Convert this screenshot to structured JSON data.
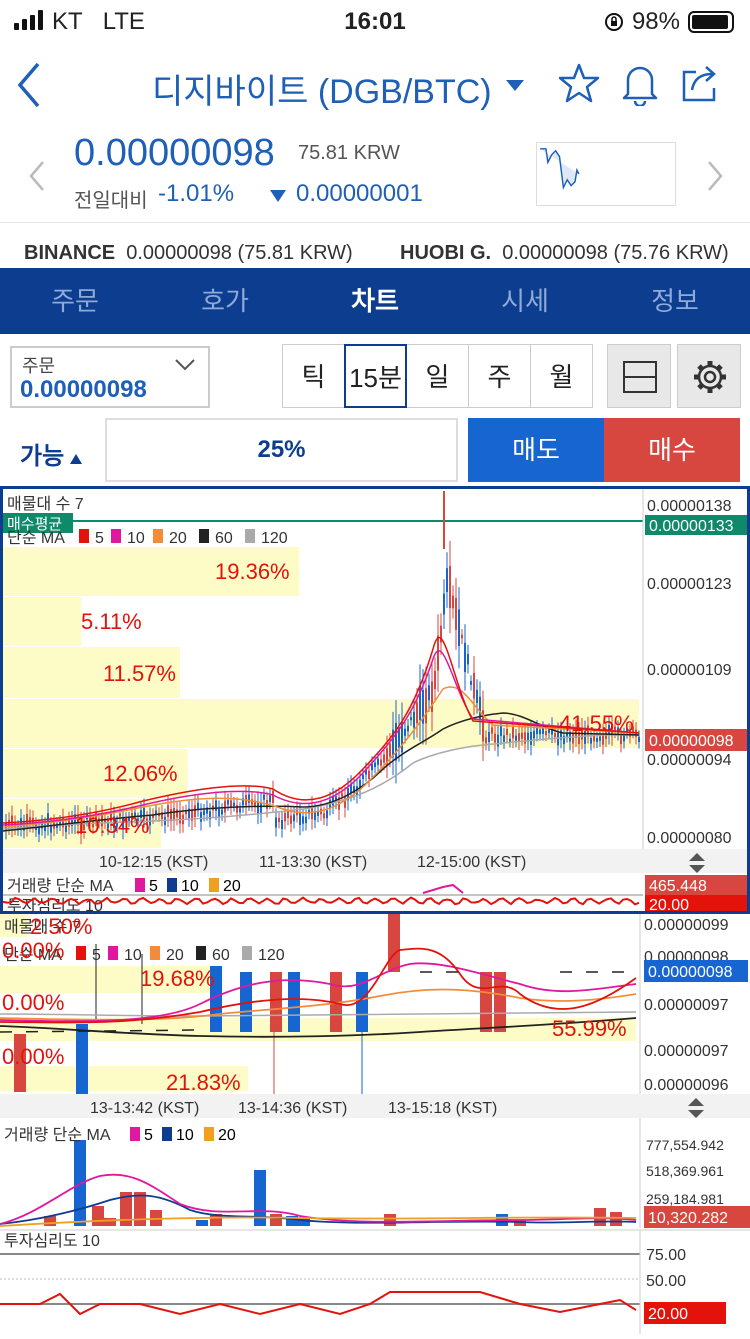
{
  "status": {
    "carrier": "KT",
    "network": "LTE",
    "time": "16:01",
    "battery": "98%"
  },
  "header": {
    "title": "디지바이트 (DGB/BTC)"
  },
  "price": {
    "value": "0.00000098",
    "krw": "75.81 KRW",
    "change_label": "전일대비",
    "change_pct": "-1.01%",
    "change_abs": "0.00000001"
  },
  "exchanges": [
    {
      "name": "BINANCE",
      "value": "0.00000098 (75.81 KRW)"
    },
    {
      "name": "HUOBI G.",
      "value": "0.00000098 (75.76 KRW)"
    }
  ],
  "tabs": [
    "주문",
    "호가",
    "차트",
    "시세",
    "정보"
  ],
  "active_tab": "차트",
  "order": {
    "label": "주문",
    "value": "0.00000098"
  },
  "periods": [
    "틱",
    "15분",
    "일",
    "주",
    "월"
  ],
  "active_period": "15분",
  "available_label": "가능",
  "percent": "25%",
  "sell_label": "매도",
  "buy_label": "매수",
  "colors": {
    "navy": "#0d3d8f",
    "blue": "#1e5fb8",
    "red": "#d7473f",
    "sell": "#1765d1"
  },
  "chart1": {
    "title": "매물대 수 7",
    "avg_label": "매수평균",
    "ma_legend": {
      "label": "단순 MA",
      "periods": [
        "5",
        "10",
        "20",
        "60",
        "120"
      ]
    },
    "yticks": [
      "0.00000138",
      "0.00000123",
      "0.00000109",
      "0.00000094",
      "0.00000080"
    ],
    "avg_price": "0.00000133",
    "cur_price": "0.00000098",
    "xticks": [
      "10-12:15 (KST)",
      "11-13:30 (KST)",
      "12-15:00 (KST)"
    ],
    "volume_profile": [
      {
        "label": "19.36%"
      },
      {
        "label": "5.11%"
      },
      {
        "label": "11.57%"
      },
      {
        "label": "41.55%"
      },
      {
        "label": "12.06%"
      },
      {
        "label": "10.34%"
      }
    ],
    "vol_legend": {
      "label": "거래량 단순 MA",
      "periods": [
        "5",
        "10",
        "20"
      ]
    },
    "vol_value": "465.448",
    "sent_label": "투자심리도 10",
    "sent_value": "20.00"
  },
  "chart2": {
    "title": "매물대 수 7",
    "ma_legend": {
      "label": "단순 MA",
      "periods": [
        "5",
        "10",
        "20",
        "60",
        "120"
      ]
    },
    "yticks": [
      "0.00000099",
      "0.00000098",
      "0.00000097",
      "0.00000097",
      "0.00000096"
    ],
    "cur_price": "0.00000098",
    "volume_profile": [
      {
        "label": "2.50%"
      },
      {
        "label": "0.00%"
      },
      {
        "label": "19.68%"
      },
      {
        "label": "0.00%"
      },
      {
        "label": "55.99%"
      },
      {
        "label": "0.00%"
      },
      {
        "label": "21.83%"
      }
    ],
    "xticks": [
      "13-13:42 (KST)",
      "13-14:36 (KST)",
      "13-15:18 (KST)"
    ],
    "vol_legend": {
      "label": "거래량 단순 MA",
      "periods": [
        "5",
        "10",
        "20"
      ]
    },
    "vol_yticks": [
      "777,554.942",
      "518,369.961",
      "259,184.981"
    ],
    "vol_value": "10,320.282",
    "sent_label": "투자심리도 10",
    "sent_yticks": [
      "75.00",
      "50.00"
    ],
    "sent_value": "20.00"
  }
}
